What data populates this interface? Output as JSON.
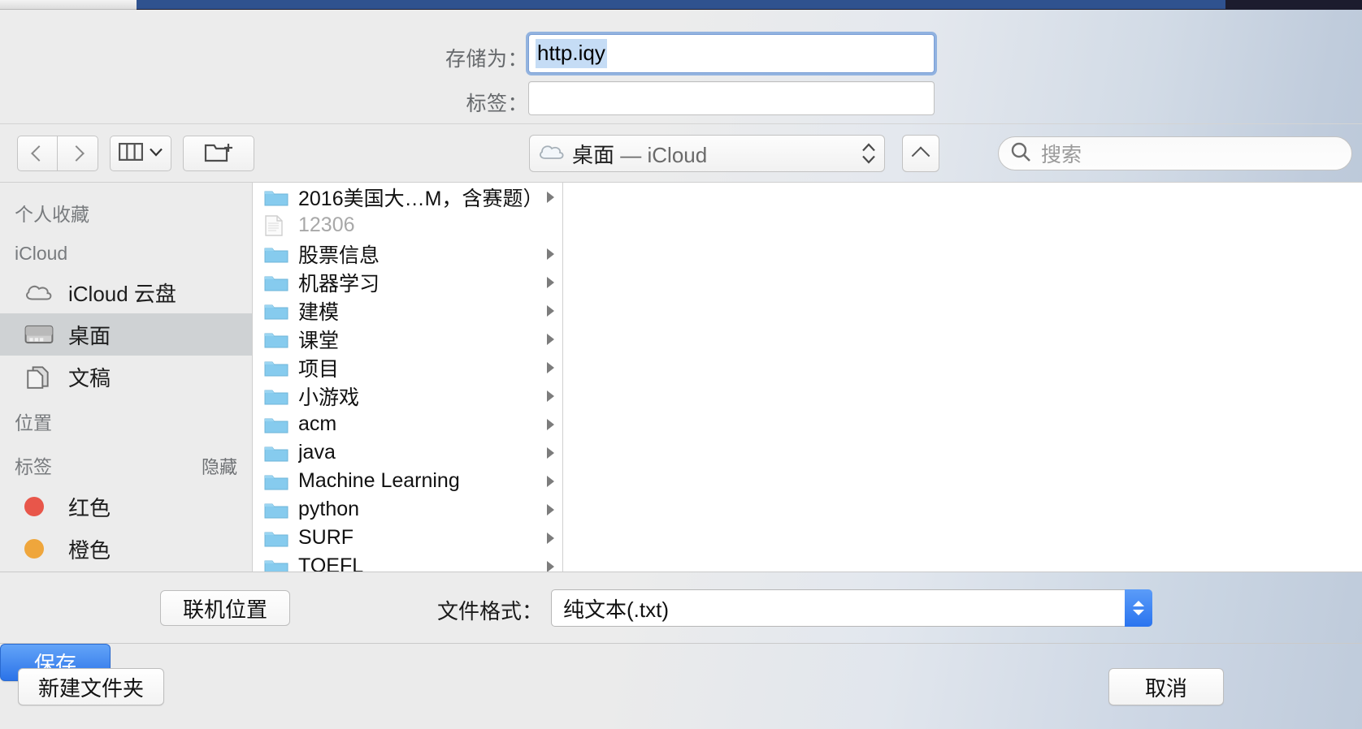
{
  "sheet": {
    "save_as_label": "存储为：",
    "tags_label": "标签：",
    "filename_value": "http.iqy",
    "tags_value": ""
  },
  "toolbar": {
    "back_icon": "chevron-left-icon",
    "forward_icon": "chevron-right-icon",
    "view_mode_icon": "column-view-icon",
    "view_mode_chevron": "chevron-down-icon",
    "new_folder_icon": "new-folder-icon",
    "path_icon": "cloud-icon",
    "path_current": "桌面",
    "path_separator": "—",
    "path_location": "iCloud",
    "collapse_icon": "chevron-up-icon",
    "search_icon": "search-icon",
    "search_placeholder": "搜索",
    "search_value": ""
  },
  "sidebar": {
    "sections": [
      {
        "title": "个人收藏",
        "action": "",
        "items": []
      },
      {
        "title": "iCloud",
        "action": "",
        "items": [
          {
            "label": "iCloud 云盘",
            "icon": "cloud-icon",
            "selected": false
          },
          {
            "label": "桌面",
            "icon": "desktop-icon",
            "selected": true
          },
          {
            "label": "文稿",
            "icon": "documents-icon",
            "selected": false
          }
        ]
      },
      {
        "title": "位置",
        "action": "",
        "items": []
      },
      {
        "title": "标签",
        "action": "隐藏",
        "items": [
          {
            "label": "红色",
            "icon": "tag-dot",
            "color": "#e8564a",
            "selected": false
          },
          {
            "label": "橙色",
            "icon": "tag-dot",
            "color": "#efa63c",
            "selected": false
          }
        ]
      }
    ]
  },
  "file_list": [
    {
      "name": "2016美国大…M，含赛题）",
      "type": "folder",
      "has_children": true,
      "disabled": false
    },
    {
      "name": "12306",
      "type": "document",
      "has_children": false,
      "disabled": true
    },
    {
      "name": "股票信息",
      "type": "folder",
      "has_children": true,
      "disabled": false
    },
    {
      "name": "机器学习",
      "type": "folder",
      "has_children": true,
      "disabled": false
    },
    {
      "name": "建模",
      "type": "folder",
      "has_children": true,
      "disabled": false
    },
    {
      "name": "课堂",
      "type": "folder",
      "has_children": true,
      "disabled": false
    },
    {
      "name": "项目",
      "type": "folder",
      "has_children": true,
      "disabled": false
    },
    {
      "name": "小游戏",
      "type": "folder",
      "has_children": true,
      "disabled": false
    },
    {
      "name": "acm",
      "type": "folder",
      "has_children": true,
      "disabled": false
    },
    {
      "name": "java",
      "type": "folder",
      "has_children": true,
      "disabled": false
    },
    {
      "name": "Machine Learning",
      "type": "folder",
      "has_children": true,
      "disabled": false
    },
    {
      "name": "python",
      "type": "folder",
      "has_children": true,
      "disabled": false
    },
    {
      "name": "SURF",
      "type": "folder",
      "has_children": true,
      "disabled": false
    },
    {
      "name": "TOEFL",
      "type": "folder",
      "has_children": true,
      "disabled": false
    }
  ],
  "format_bar": {
    "online_locations_label": "联机位置",
    "format_label": "文件格式：",
    "format_value": "纯文本(.txt)"
  },
  "actions": {
    "new_folder_label": "新建文件夹",
    "cancel_label": "取消",
    "save_label": "保存"
  },
  "colors": {
    "accent": "#2b73e8",
    "selection_highlight": "#c5dcf5",
    "folder_blue": "#7ec6ef",
    "sidebar_selected": "#cfd2d4",
    "backdrop_titlebar": "#2f528f"
  }
}
